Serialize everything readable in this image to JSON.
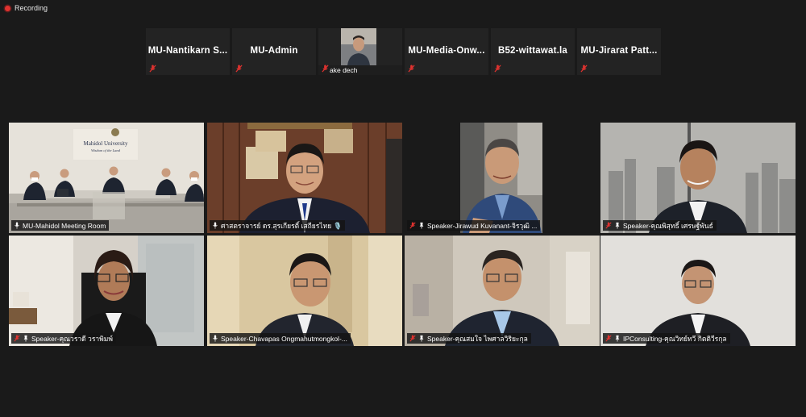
{
  "recording": {
    "label": "Recording"
  },
  "strip": [
    {
      "name": "MU-Nantikarn  S...",
      "muted": true
    },
    {
      "name": "MU-Admin",
      "muted": true
    },
    {
      "name": "ake dech",
      "muted": true,
      "video": true
    },
    {
      "name": "MU-Media-Onw...",
      "muted": true
    },
    {
      "name": "B52-wittawat.la",
      "muted": true
    },
    {
      "name": "MU-Jirarat  Patt...",
      "muted": true
    }
  ],
  "grid": [
    {
      "name": "MU-Mahidol Meeting Room",
      "muted": false,
      "active": true,
      "sign_line1": "Mahidol University",
      "sign_line2": "Wisdom of the Land"
    },
    {
      "name": "ศาสตราจารย์ ดร.สุรเกียรติ์ เสถียรไทย 🎙️",
      "muted": false
    },
    {
      "name": "Speaker-Jirawud Kuvanant-จิรวุฒิ ...",
      "muted": true
    },
    {
      "name": "Speaker-คุณพิสุทธิ์ เศรษฐ์พันธ์",
      "muted": true
    },
    {
      "name": "Speaker-คุณวราดี วราพิมพ์",
      "muted": true
    },
    {
      "name": "Speaker-Chavapas Ongmahutmongkol-...",
      "muted": false
    },
    {
      "name": "Speaker-คุณสมใจ ไพศาลวิริยะกุล",
      "muted": true
    },
    {
      "name": "IPConsulting-คุณวิทย์ทวี กิตติวีรกุล",
      "muted": true
    }
  ],
  "colors": {
    "mute_red": "#e0322f",
    "active_border": "#c4e33a",
    "bg": "#1a1a1a"
  }
}
